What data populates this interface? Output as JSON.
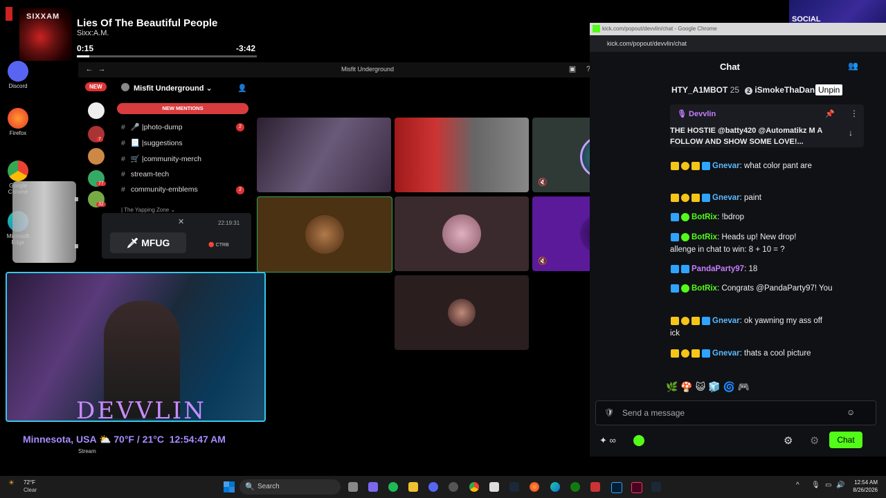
{
  "desktop": {
    "icons": [
      {
        "label": "Discord"
      },
      {
        "label": "Firefox"
      },
      {
        "label": "Google Chrome"
      },
      {
        "label": "Microsoft Edge"
      }
    ]
  },
  "music": {
    "album_text": "SIXXAM",
    "title": "Lies Of The Beautiful People",
    "artist": "Sixx:A.M.",
    "current_time": "0:15",
    "remaining_time": "-3:42",
    "progress": 0.07
  },
  "discord": {
    "window_title": "Misfit Underground",
    "server_name": "Misfit Underground",
    "new_label": "NEW",
    "new_mentions": "NEW MENTIONS",
    "server_badges": [
      "7",
      "77",
      "32"
    ],
    "channels": [
      {
        "name": "photo-dump",
        "emoji": "🎤",
        "badge": "2"
      },
      {
        "name": "suggestions",
        "emoji": "📃",
        "badge": ""
      },
      {
        "name": "community-merch",
        "emoji": "🛒",
        "badge": ""
      },
      {
        "name": "stream-tech",
        "emoji": "",
        "badge": ""
      },
      {
        "name": "community-emblems",
        "emoji": "",
        "badge": "2"
      }
    ],
    "category": "The Yapping Zone",
    "popup_label": "MFUG",
    "popup_time": "22:19:31",
    "popup_user": "CTRB"
  },
  "chrome": {
    "title": "kick.com/popout/devvlin/chat - Google Chrome",
    "url": "kick.com/popout/devvlin/chat",
    "chat_header": "Chat",
    "top_gifters": [
      {
        "name": "HTY_A1MBOT",
        "count": "25"
      },
      {
        "name": "iSmokeThaDan",
        "rank": "2"
      }
    ],
    "unpin_tooltip": "Unpin",
    "pinned": {
      "user": "Devvlin",
      "text": "THE HOSTIE @batty420 @Automatikz M A FOLLOW AND SHOW SOME LOVE!..."
    },
    "messages": [
      {
        "user": "Gnevar",
        "color": "#5db9ff",
        "text": ": what color pant are"
      },
      {
        "user": "Gnevar",
        "color": "#5db9ff",
        "text": ": paint"
      },
      {
        "user": "BotRix",
        "color": "#53fc18",
        "text": ": !bdrop"
      },
      {
        "user": "BotRix",
        "color": "#53fc18",
        "text": ": Heads up! New drop!"
      },
      {
        "user": "",
        "color": "#eee",
        "text": "allenge in chat to win: 8 + 10 = ?"
      },
      {
        "user": "PandaParty97",
        "color": "#c77dff",
        "text": ": 18"
      },
      {
        "user": "BotRix",
        "color": "#53fc18",
        "text": ": Congrats @PandaParty97! You"
      },
      {
        "user": "Gnevar",
        "color": "#5db9ff",
        "text": ": ok yawning my ass off"
      },
      {
        "user": "",
        "color": "#eee",
        "text": "ick"
      },
      {
        "user": "Gnevar",
        "color": "#5db9ff",
        "text": ": thats a cool picture"
      }
    ],
    "message_placeholder": "Send a message",
    "chat_button": "Chat"
  },
  "overlay": {
    "logo_text": "DEVVLIN",
    "weather_line": "Minnesota, USA",
    "temperature": "70°F / 21°C",
    "clock": "12:54:47 AM",
    "stream_label": "Stream"
  },
  "promo": {
    "text": "SOCIAL SPORTS GAMING"
  },
  "taskbar": {
    "weather_temp": "72°F",
    "weather_desc": "Clear",
    "search_placeholder": "Search",
    "time": "12:54 AM",
    "date": "8/26/2026"
  }
}
